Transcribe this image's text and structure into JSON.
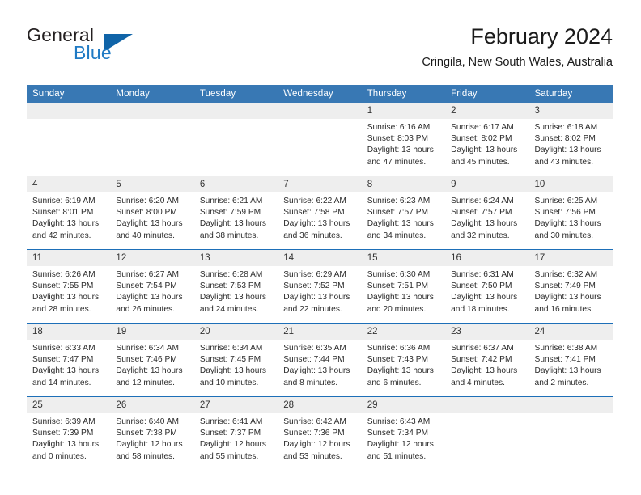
{
  "brand": {
    "name_part1": "General",
    "name_part2": "Blue",
    "logo_icon": "triangle-logo-icon"
  },
  "header": {
    "title": "February 2024",
    "location": "Cringila, New South Wales, Australia"
  },
  "calendar": {
    "weekday_headers": [
      "Sunday",
      "Monday",
      "Tuesday",
      "Wednesday",
      "Thursday",
      "Friday",
      "Saturday"
    ],
    "accent_color": "#3878b4",
    "separator_color": "#1d6fb8",
    "daynum_band_color": "#eeeeee",
    "weeks": [
      [
        {
          "day": "",
          "sunrise": "",
          "sunset": "",
          "daylight_line1": "",
          "daylight_line2": ""
        },
        {
          "day": "",
          "sunrise": "",
          "sunset": "",
          "daylight_line1": "",
          "daylight_line2": ""
        },
        {
          "day": "",
          "sunrise": "",
          "sunset": "",
          "daylight_line1": "",
          "daylight_line2": ""
        },
        {
          "day": "",
          "sunrise": "",
          "sunset": "",
          "daylight_line1": "",
          "daylight_line2": ""
        },
        {
          "day": "1",
          "sunrise": "Sunrise: 6:16 AM",
          "sunset": "Sunset: 8:03 PM",
          "daylight_line1": "Daylight: 13 hours",
          "daylight_line2": "and 47 minutes."
        },
        {
          "day": "2",
          "sunrise": "Sunrise: 6:17 AM",
          "sunset": "Sunset: 8:02 PM",
          "daylight_line1": "Daylight: 13 hours",
          "daylight_line2": "and 45 minutes."
        },
        {
          "day": "3",
          "sunrise": "Sunrise: 6:18 AM",
          "sunset": "Sunset: 8:02 PM",
          "daylight_line1": "Daylight: 13 hours",
          "daylight_line2": "and 43 minutes."
        }
      ],
      [
        {
          "day": "4",
          "sunrise": "Sunrise: 6:19 AM",
          "sunset": "Sunset: 8:01 PM",
          "daylight_line1": "Daylight: 13 hours",
          "daylight_line2": "and 42 minutes."
        },
        {
          "day": "5",
          "sunrise": "Sunrise: 6:20 AM",
          "sunset": "Sunset: 8:00 PM",
          "daylight_line1": "Daylight: 13 hours",
          "daylight_line2": "and 40 minutes."
        },
        {
          "day": "6",
          "sunrise": "Sunrise: 6:21 AM",
          "sunset": "Sunset: 7:59 PM",
          "daylight_line1": "Daylight: 13 hours",
          "daylight_line2": "and 38 minutes."
        },
        {
          "day": "7",
          "sunrise": "Sunrise: 6:22 AM",
          "sunset": "Sunset: 7:58 PM",
          "daylight_line1": "Daylight: 13 hours",
          "daylight_line2": "and 36 minutes."
        },
        {
          "day": "8",
          "sunrise": "Sunrise: 6:23 AM",
          "sunset": "Sunset: 7:57 PM",
          "daylight_line1": "Daylight: 13 hours",
          "daylight_line2": "and 34 minutes."
        },
        {
          "day": "9",
          "sunrise": "Sunrise: 6:24 AM",
          "sunset": "Sunset: 7:57 PM",
          "daylight_line1": "Daylight: 13 hours",
          "daylight_line2": "and 32 minutes."
        },
        {
          "day": "10",
          "sunrise": "Sunrise: 6:25 AM",
          "sunset": "Sunset: 7:56 PM",
          "daylight_line1": "Daylight: 13 hours",
          "daylight_line2": "and 30 minutes."
        }
      ],
      [
        {
          "day": "11",
          "sunrise": "Sunrise: 6:26 AM",
          "sunset": "Sunset: 7:55 PM",
          "daylight_line1": "Daylight: 13 hours",
          "daylight_line2": "and 28 minutes."
        },
        {
          "day": "12",
          "sunrise": "Sunrise: 6:27 AM",
          "sunset": "Sunset: 7:54 PM",
          "daylight_line1": "Daylight: 13 hours",
          "daylight_line2": "and 26 minutes."
        },
        {
          "day": "13",
          "sunrise": "Sunrise: 6:28 AM",
          "sunset": "Sunset: 7:53 PM",
          "daylight_line1": "Daylight: 13 hours",
          "daylight_line2": "and 24 minutes."
        },
        {
          "day": "14",
          "sunrise": "Sunrise: 6:29 AM",
          "sunset": "Sunset: 7:52 PM",
          "daylight_line1": "Daylight: 13 hours",
          "daylight_line2": "and 22 minutes."
        },
        {
          "day": "15",
          "sunrise": "Sunrise: 6:30 AM",
          "sunset": "Sunset: 7:51 PM",
          "daylight_line1": "Daylight: 13 hours",
          "daylight_line2": "and 20 minutes."
        },
        {
          "day": "16",
          "sunrise": "Sunrise: 6:31 AM",
          "sunset": "Sunset: 7:50 PM",
          "daylight_line1": "Daylight: 13 hours",
          "daylight_line2": "and 18 minutes."
        },
        {
          "day": "17",
          "sunrise": "Sunrise: 6:32 AM",
          "sunset": "Sunset: 7:49 PM",
          "daylight_line1": "Daylight: 13 hours",
          "daylight_line2": "and 16 minutes."
        }
      ],
      [
        {
          "day": "18",
          "sunrise": "Sunrise: 6:33 AM",
          "sunset": "Sunset: 7:47 PM",
          "daylight_line1": "Daylight: 13 hours",
          "daylight_line2": "and 14 minutes."
        },
        {
          "day": "19",
          "sunrise": "Sunrise: 6:34 AM",
          "sunset": "Sunset: 7:46 PM",
          "daylight_line1": "Daylight: 13 hours",
          "daylight_line2": "and 12 minutes."
        },
        {
          "day": "20",
          "sunrise": "Sunrise: 6:34 AM",
          "sunset": "Sunset: 7:45 PM",
          "daylight_line1": "Daylight: 13 hours",
          "daylight_line2": "and 10 minutes."
        },
        {
          "day": "21",
          "sunrise": "Sunrise: 6:35 AM",
          "sunset": "Sunset: 7:44 PM",
          "daylight_line1": "Daylight: 13 hours",
          "daylight_line2": "and 8 minutes."
        },
        {
          "day": "22",
          "sunrise": "Sunrise: 6:36 AM",
          "sunset": "Sunset: 7:43 PM",
          "daylight_line1": "Daylight: 13 hours",
          "daylight_line2": "and 6 minutes."
        },
        {
          "day": "23",
          "sunrise": "Sunrise: 6:37 AM",
          "sunset": "Sunset: 7:42 PM",
          "daylight_line1": "Daylight: 13 hours",
          "daylight_line2": "and 4 minutes."
        },
        {
          "day": "24",
          "sunrise": "Sunrise: 6:38 AM",
          "sunset": "Sunset: 7:41 PM",
          "daylight_line1": "Daylight: 13 hours",
          "daylight_line2": "and 2 minutes."
        }
      ],
      [
        {
          "day": "25",
          "sunrise": "Sunrise: 6:39 AM",
          "sunset": "Sunset: 7:39 PM",
          "daylight_line1": "Daylight: 13 hours",
          "daylight_line2": "and 0 minutes."
        },
        {
          "day": "26",
          "sunrise": "Sunrise: 6:40 AM",
          "sunset": "Sunset: 7:38 PM",
          "daylight_line1": "Daylight: 12 hours",
          "daylight_line2": "and 58 minutes."
        },
        {
          "day": "27",
          "sunrise": "Sunrise: 6:41 AM",
          "sunset": "Sunset: 7:37 PM",
          "daylight_line1": "Daylight: 12 hours",
          "daylight_line2": "and 55 minutes."
        },
        {
          "day": "28",
          "sunrise": "Sunrise: 6:42 AM",
          "sunset": "Sunset: 7:36 PM",
          "daylight_line1": "Daylight: 12 hours",
          "daylight_line2": "and 53 minutes."
        },
        {
          "day": "29",
          "sunrise": "Sunrise: 6:43 AM",
          "sunset": "Sunset: 7:34 PM",
          "daylight_line1": "Daylight: 12 hours",
          "daylight_line2": "and 51 minutes."
        },
        {
          "day": "",
          "sunrise": "",
          "sunset": "",
          "daylight_line1": "",
          "daylight_line2": ""
        },
        {
          "day": "",
          "sunrise": "",
          "sunset": "",
          "daylight_line1": "",
          "daylight_line2": ""
        }
      ]
    ]
  }
}
